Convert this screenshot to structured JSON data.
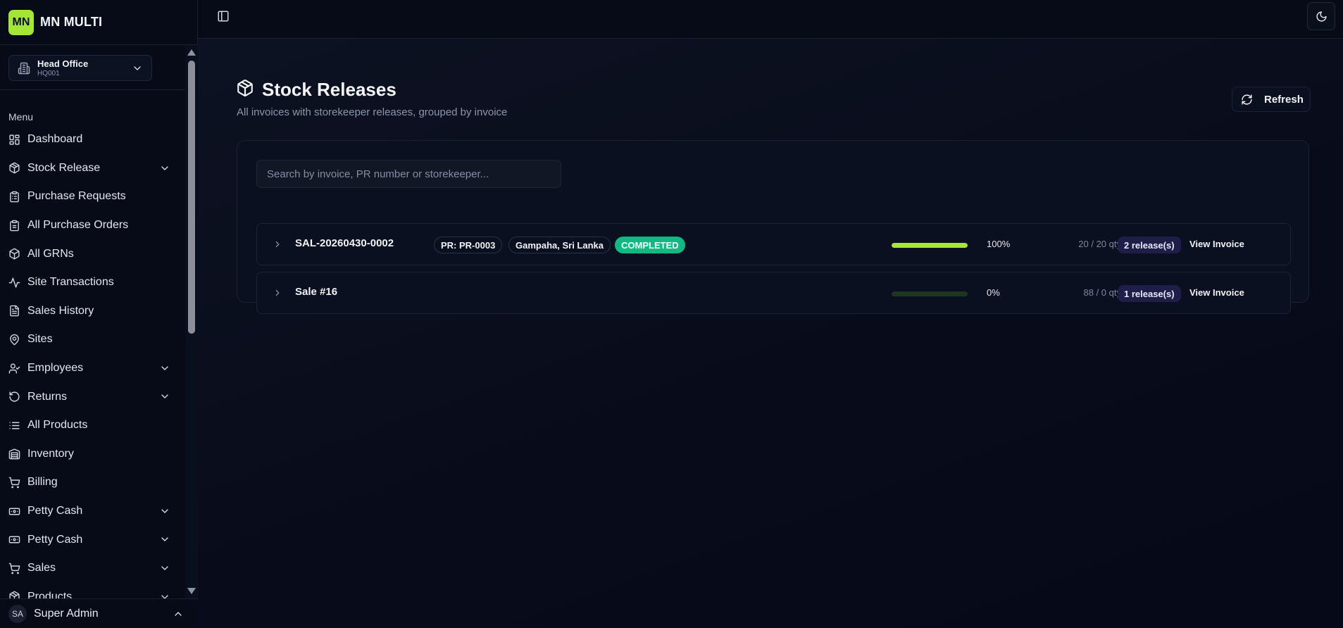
{
  "app": {
    "logo_text": "MN",
    "name": "MN MULTI"
  },
  "branch": {
    "name": "Head Office",
    "code": "HQ001"
  },
  "menu": {
    "title": "Menu",
    "items": [
      {
        "label": "Dashboard",
        "icon": "dashboard-icon",
        "has_chevron": false
      },
      {
        "label": "Stock Release",
        "icon": "package-icon",
        "has_chevron": true
      },
      {
        "label": "Purchase Requests",
        "icon": "clipboard-icon",
        "has_chevron": false
      },
      {
        "label": "All Purchase Orders",
        "icon": "clipboard-list-icon",
        "has_chevron": false
      },
      {
        "label": "All GRNs",
        "icon": "box-icon",
        "has_chevron": false
      },
      {
        "label": "Site Transactions",
        "icon": "activity-icon",
        "has_chevron": false
      },
      {
        "label": "Sales History",
        "icon": "file-text-icon",
        "has_chevron": false
      },
      {
        "label": "Sites",
        "icon": "map-pin-icon",
        "has_chevron": false
      },
      {
        "label": "Employees",
        "icon": "user-check-icon",
        "has_chevron": true
      },
      {
        "label": "Returns",
        "icon": "rotate-ccw-icon",
        "has_chevron": true
      },
      {
        "label": "All Products",
        "icon": "list-icon",
        "has_chevron": false
      },
      {
        "label": "Inventory",
        "icon": "warehouse-icon",
        "has_chevron": false
      },
      {
        "label": "Billing",
        "icon": "cart-icon",
        "has_chevron": false
      },
      {
        "label": "Petty Cash",
        "icon": "banknote-icon",
        "has_chevron": true
      },
      {
        "label": "Petty Cash",
        "icon": "banknote-icon",
        "has_chevron": true
      },
      {
        "label": "Sales",
        "icon": "cart-icon",
        "has_chevron": true
      },
      {
        "label": "Products",
        "icon": "package-icon",
        "has_chevron": true
      }
    ]
  },
  "user": {
    "initials": "SA",
    "name": "Super Admin"
  },
  "page": {
    "title": "Stock Releases",
    "subtitle": "All invoices with storekeeper releases, grouped by invoice",
    "refresh_label": "Refresh",
    "search_placeholder": "Search by invoice, PR number or storekeeper..."
  },
  "releases": [
    {
      "invoice": "SAL-20260430-0002",
      "pr_badge": "PR: PR-0003",
      "location_badge": "Gampaha, Sri Lanka",
      "status_badge": "COMPLETED",
      "progress": 1.0,
      "percent_text": "100%",
      "qty_text": "20 / 20 qty",
      "release_count": "2 release(s)",
      "action": "View Invoice"
    },
    {
      "invoice": "Sale #16",
      "progress": 0.0,
      "percent_text": "0%",
      "qty_text": "88 / 0 qty",
      "release_count": "1 release(s)",
      "action": "View Invoice"
    }
  ],
  "colors": {
    "accent": "#a3e635",
    "status_completed": "#10b981",
    "release_badge_bg": "#1f1e48",
    "background": "#070b18"
  }
}
